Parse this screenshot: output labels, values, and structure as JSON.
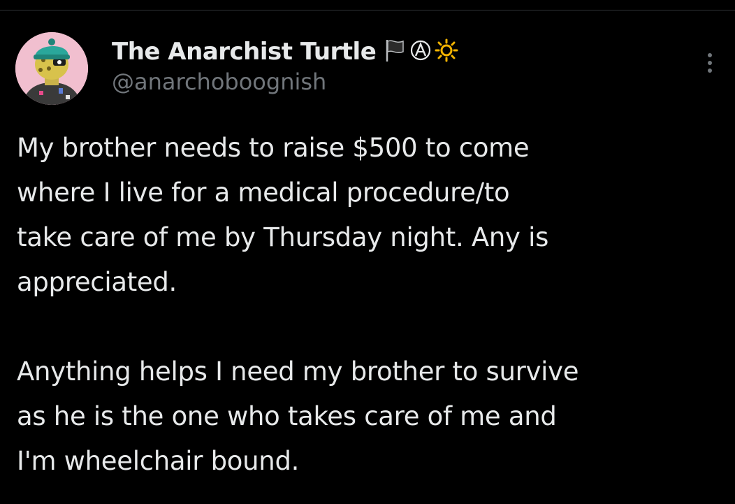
{
  "tweet": {
    "author": {
      "display_name": "The Anarchist Turtle",
      "handle": "@anarchoboognish",
      "badges": [
        "black-flag-icon",
        "circle-a-icon",
        "sun-icon"
      ],
      "avatar": "turtle-avatar"
    },
    "more_menu": "more-options-icon",
    "text": {
      "paragraph1": {
        "lines": [
          "My brother needs to raise $500 to come",
          "where I live for a medical procedure/to",
          "take care of me by Thursday night. Any is",
          "appreciated."
        ]
      },
      "paragraph2": {
        "lines": [
          "Anything helps I need my brother to survive",
          "as he is the one who takes care of me and",
          "I'm wheelchair bound."
        ]
      }
    }
  },
  "colors": {
    "background": "#000000",
    "primary_text": "#e7e9ea",
    "secondary_text": "#71767b",
    "divider": "#2f3336",
    "avatar_bg": "#f1bfcf",
    "badge_sun": "#f4b400"
  }
}
